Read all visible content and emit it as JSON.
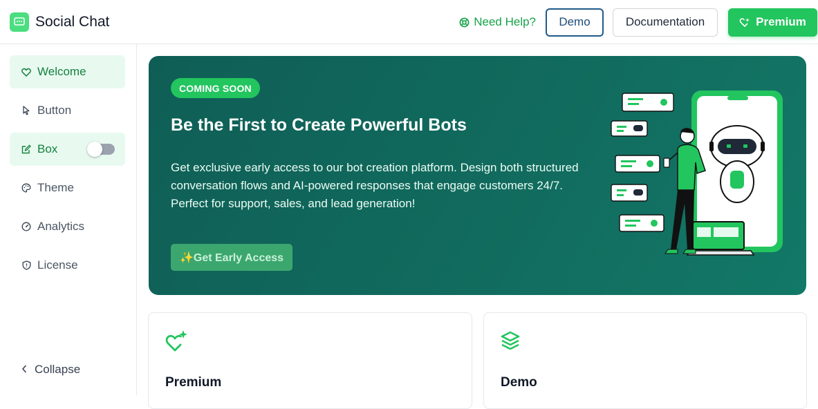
{
  "app": {
    "title": "Social Chat"
  },
  "header": {
    "help_label": "Need Help?",
    "demo_label": "Demo",
    "documentation_label": "Documentation",
    "premium_label": "Premium"
  },
  "sidebar": {
    "items": [
      {
        "label": "Welcome",
        "icon": "heart-icon",
        "active": true
      },
      {
        "label": "Button",
        "icon": "cursor-icon",
        "active": false
      },
      {
        "label": "Box",
        "icon": "edit-box-icon",
        "active": true,
        "toggle_on": false
      },
      {
        "label": "Theme",
        "icon": "palette-icon",
        "active": false
      },
      {
        "label": "Analytics",
        "icon": "gauge-icon",
        "active": false
      },
      {
        "label": "License",
        "icon": "shield-icon",
        "active": false
      }
    ],
    "collapse_label": "Collapse"
  },
  "hero": {
    "badge": "COMING SOON",
    "title": "Be the First to Create Powerful Bots",
    "description": "Get exclusive early access to our bot creation platform. Design both structured conversation flows and AI-powered responses that engage customers 24/7. Perfect for support, sales, and lead generation!",
    "cta_label": "✨Get Early Access"
  },
  "cards": [
    {
      "title": "Premium",
      "icon": "heart-sparkle-icon"
    },
    {
      "title": "Demo",
      "icon": "layers-icon"
    }
  ],
  "colors": {
    "accent": "#22c55e",
    "accent_dark": "#16a34a",
    "hero_bg": "#116b5e",
    "demo_border": "#1e5a8a"
  }
}
